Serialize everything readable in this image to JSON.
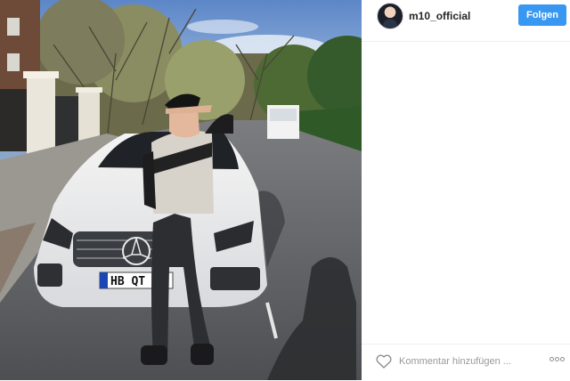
{
  "post": {
    "photo_icon": "car-portrait-photo"
  },
  "header": {
    "username": "m10_official",
    "follow_label": "Folgen",
    "avatar_icon": "avatar-icon",
    "accent_color": "#3897f0"
  },
  "comment_bar": {
    "placeholder": "Kommentar hinzufügen ...",
    "like_icon": "heart-icon",
    "more_icon": "more-options-icon"
  }
}
